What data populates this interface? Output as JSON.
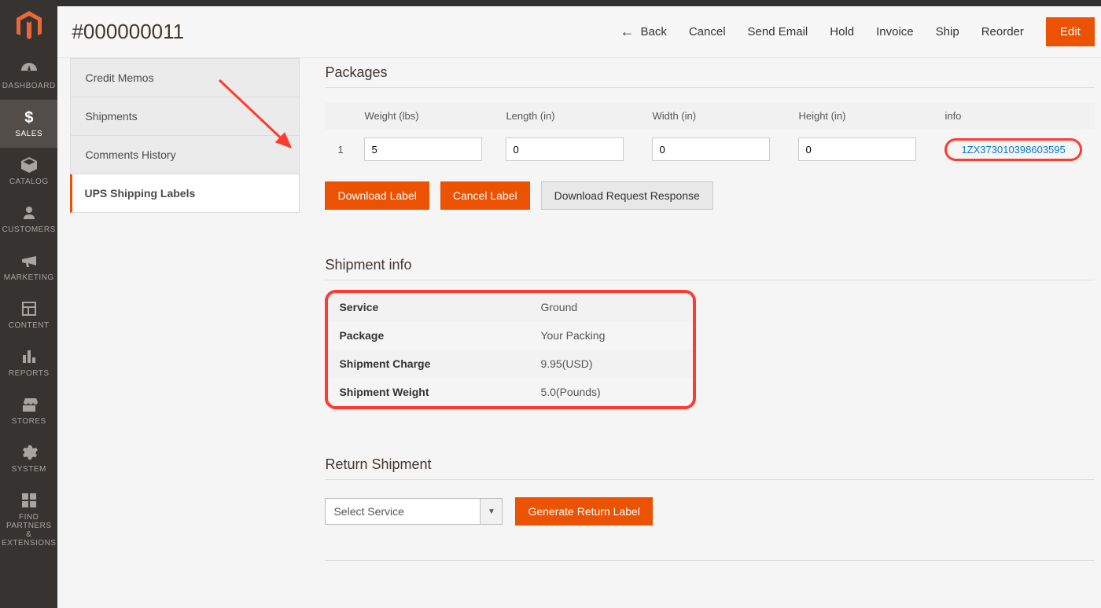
{
  "colors": {
    "accent": "#eb5202",
    "highlight": "#ff3b30",
    "link": "#0a7acc"
  },
  "nav": {
    "items": [
      {
        "label": "DASHBOARD"
      },
      {
        "label": "SALES"
      },
      {
        "label": "CATALOG"
      },
      {
        "label": "CUSTOMERS"
      },
      {
        "label": "MARKETING"
      },
      {
        "label": "CONTENT"
      },
      {
        "label": "REPORTS"
      },
      {
        "label": "STORES"
      },
      {
        "label": "SYSTEM"
      },
      {
        "label": "FIND PARTNERS\n& EXTENSIONS"
      }
    ]
  },
  "header": {
    "title": "#000000011",
    "actions": {
      "back": "Back",
      "cancel": "Cancel",
      "send_email": "Send Email",
      "hold": "Hold",
      "invoice": "Invoice",
      "ship": "Ship",
      "reorder": "Reorder",
      "edit": "Edit"
    }
  },
  "tabs": {
    "items": [
      {
        "label": "Credit Memos"
      },
      {
        "label": "Shipments"
      },
      {
        "label": "Comments History"
      },
      {
        "label": "UPS Shipping Labels"
      }
    ]
  },
  "packages": {
    "title": "Packages",
    "columns": {
      "weight": "Weight (lbs)",
      "length": "Length (in)",
      "width": "Width (in)",
      "height": "Height (in)",
      "info": "info"
    },
    "rows": [
      {
        "idx": "1",
        "weight": "5",
        "length": "0",
        "width": "0",
        "height": "0",
        "info": "1ZX373010398603595"
      }
    ],
    "buttons": {
      "download": "Download Label",
      "cancel": "Cancel Label",
      "drr": "Download Request Response"
    }
  },
  "shipment_info": {
    "title": "Shipment info",
    "rows": [
      {
        "k": "Service",
        "v": "Ground"
      },
      {
        "k": "Package",
        "v": "Your Packing"
      },
      {
        "k": "Shipment Charge",
        "v": "9.95(USD)"
      },
      {
        "k": "Shipment Weight",
        "v": "5.0(Pounds)"
      }
    ]
  },
  "return": {
    "title": "Return Shipment",
    "select_placeholder": "Select Service",
    "button": "Generate Return Label"
  }
}
